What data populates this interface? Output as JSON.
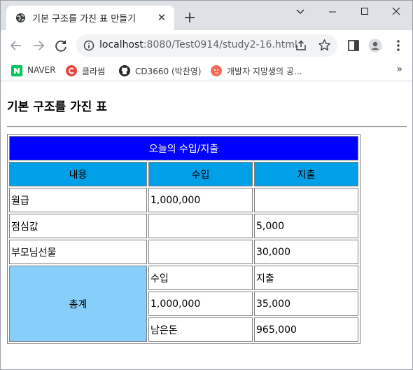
{
  "browser": {
    "tab_title": "기본 구조를 가진 표 만들기",
    "url_host": "localhost",
    "url_path": ":8080/Test0914/study2-16.html",
    "bookmarks": [
      {
        "label": "NAVER",
        "icon": "naver-icon",
        "color": "#03c75a"
      },
      {
        "label": "클라썸",
        "icon": "classum-icon",
        "color": "#e8453c"
      },
      {
        "label": "CD3660 (박찬영)",
        "icon": "github-icon",
        "color": "#24292f"
      },
      {
        "label": "개발자 지망생의 공...",
        "icon": "blog-icon",
        "color": "#f26b5b"
      }
    ],
    "more_bookmarks": "»"
  },
  "page": {
    "title": "기본 구조를 가진 표",
    "table": {
      "caption": "오늘의 수입/지출",
      "headers": [
        "내용",
        "수입",
        "지출"
      ],
      "rows": [
        [
          "월급",
          "1,000,000",
          ""
        ],
        [
          "점심값",
          "",
          "5,000"
        ],
        [
          "부모님선물",
          "",
          "30,000"
        ]
      ],
      "total_label": "총계",
      "total_rows": [
        [
          "수입",
          "지출"
        ],
        [
          "1,000,000",
          "35,000"
        ],
        [
          "남은돈",
          "965,000"
        ]
      ]
    }
  },
  "colors": {
    "caption_bg": "#0000ff",
    "header_bg": "#00a0e8",
    "total_bg": "#87cefa"
  }
}
